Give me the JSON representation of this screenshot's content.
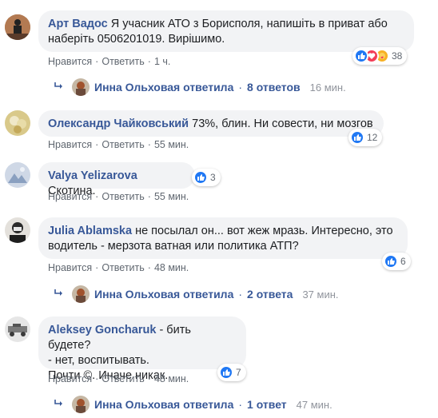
{
  "comments": [
    {
      "author": "Арт Вадос",
      "text1": "Я учасник АТО з Борисполя, напишіть в приват або",
      "text2": "наберіть 0506201019. Вирішимо.",
      "like": "Нравится",
      "reply": "Ответить",
      "time": "1 ч.",
      "reactions": "38",
      "replies": {
        "name": "Инна Ольховая",
        "verb": "ответила",
        "count": "8 ответов",
        "time": "16 мин."
      }
    },
    {
      "author": "Олександр Чайковський",
      "text1": "73%, блин. Ни совести, ни мозгов",
      "like": "Нравится",
      "reply": "Ответить",
      "time": "55 мин.",
      "reactions": "12"
    },
    {
      "author": "Valya Yelizarova",
      "text1": "Скотина.",
      "like": "Нравится",
      "reply": "Ответить",
      "time": "55 мин.",
      "reactions": "3"
    },
    {
      "author": "Julia Ablamska",
      "text1": "не посылал он... вот жеж мразь. Интересно, это",
      "text2": "водитель - мерзота ватная или политика АТП?",
      "like": "Нравится",
      "reply": "Ответить",
      "time": "48 мин.",
      "reactions": "6",
      "replies": {
        "name": "Инна Ольховая",
        "verb": "ответила",
        "count": "2 ответа",
        "time": "37 мин."
      }
    },
    {
      "author": "Aleksey Goncharuk",
      "text1": "- бить будете?",
      "text2": "- нет, воспитывать.",
      "text3": "Почти ©. Иначе никак.",
      "like": "Нравится",
      "reply": "Ответить",
      "time": "48 мин.",
      "reactions": "7",
      "replies": {
        "name": "Инна Ольховая",
        "verb": "ответила",
        "count": "1 ответ",
        "time": "47 мин."
      }
    }
  ],
  "icons": {
    "like": "thumbs-up-icon",
    "love": "heart-icon",
    "care": "care-icon",
    "reply_arrow": "reply-arrow-icon"
  },
  "colors": {
    "link": "#385898",
    "bubble": "#f2f3f5",
    "meta": "#606770",
    "like": "#2078f4",
    "love": "#f33e58",
    "care": "#f7b125"
  }
}
